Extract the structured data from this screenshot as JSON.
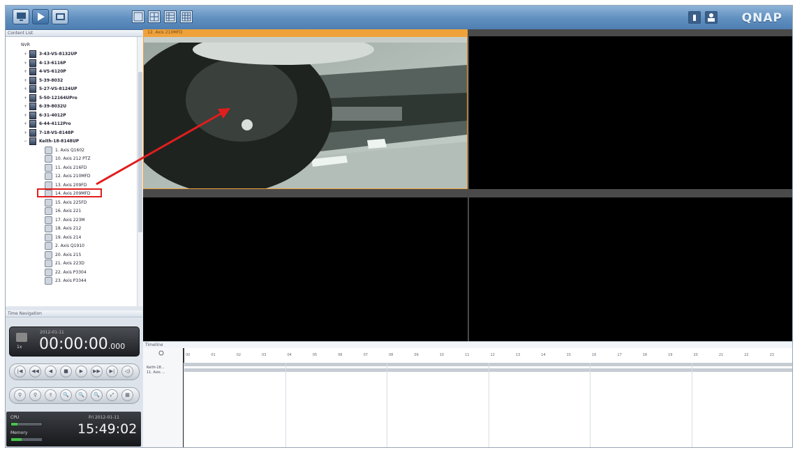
{
  "brand": "QNAP",
  "panels": {
    "content_list": "Content List",
    "time_navigation": "Time Navigation",
    "timeline": "Timeline"
  },
  "tree": {
    "root": "NVR",
    "servers": [
      "3-43-VS-8132UP",
      "4-13-6116P",
      "4-VS-6120P",
      "5-39-8032",
      "5-27-VS-8124UP",
      "5-50-12164UPro",
      "6-39-8032U",
      "6-31-4012P",
      "6-44-4112Pro",
      "7-18-VS-8148P",
      "Keith-18-8148UP"
    ],
    "cameras": [
      "1. Axis Q1602",
      "10. Axis 212 PTZ",
      "11. Axis 216FD",
      "12. Axis 210MFD",
      "13. Axis 209FD",
      "14. Axis 209MFD",
      "15. Axis 225FD",
      "16. Axis 221",
      "17. Axis 223M",
      "18. Axis 212",
      "19. Axis 214",
      "2. Axis Q1910",
      "20. Axis 215",
      "21. Axis 223D",
      "22. Axis P3304",
      "23. Axis P3344"
    ]
  },
  "selected_camera_title": "12. Axis 210MFD",
  "playback": {
    "date": "2012-01-11",
    "time": "00:00:00",
    "ms": ".000",
    "speed": "1x",
    "controls": [
      "|◀",
      "◀◀",
      "◀",
      "■",
      "▶",
      "▶▶",
      "▶|",
      "◁)"
    ],
    "tools": [
      "⚲",
      "⚲",
      "⇪",
      "🔍",
      "🔍",
      "🔍",
      "⤢",
      "▦"
    ]
  },
  "status": {
    "cpu_label": "CPU",
    "memory_label": "Memory",
    "cpu_usage": 0.2,
    "memory_usage": 0.35,
    "date": "Fri 2012-01-11",
    "time": "15:49:02"
  },
  "timeline": {
    "camera_label": "Keith-18...",
    "camera_sublabel": "11. Axis ...",
    "hours": [
      "00",
      "01",
      "02",
      "03",
      "04",
      "05",
      "06",
      "07",
      "08",
      "09",
      "10",
      "11",
      "12",
      "13",
      "14",
      "15",
      "16",
      "17",
      "18",
      "19",
      "20",
      "21",
      "22",
      "23"
    ]
  },
  "colors": {
    "accent": "#f0a23a",
    "highlight": "#e21d1d",
    "topbar": "#5f8fbf"
  }
}
